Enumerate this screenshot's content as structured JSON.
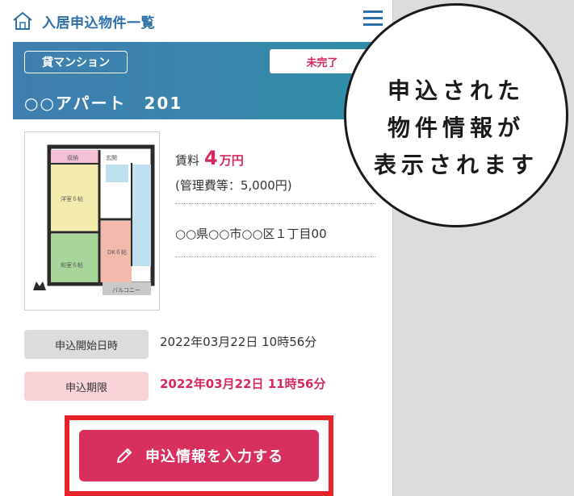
{
  "header": {
    "title": "入居申込物件一覧",
    "home_icon": "home-icon",
    "menu_icon": "hamburger-menu-icon"
  },
  "property": {
    "type_badge": "貸マンション",
    "status_badge": "未完了",
    "name": "○○アパート　201",
    "rent_label": "賃料",
    "rent_value": "4",
    "rent_unit": "万円",
    "management_fee": "(管理費等：5,000円)",
    "address": "○○県○○市○○区１丁目00"
  },
  "floorplan": {
    "rooms": {
      "storage": "収納",
      "entrance": "玄関",
      "western_room": "洋室６帖",
      "japanese_room": "和室６帖",
      "dk": "DK６帖",
      "balcony": "バルコニー"
    }
  },
  "application": {
    "start_label": "申込開始日時",
    "start_value": "2022年03月22日 10時56分",
    "deadline_label": "申込期限",
    "deadline_value": "2022年03月22日 11時56分"
  },
  "actions": {
    "submit_label": "申込情報を入力する",
    "submit_icon": "pencil-icon"
  },
  "callout": {
    "lines": [
      "申込された",
      "物件情報が",
      "表示されます"
    ]
  },
  "colors": {
    "accent": "#d6285a",
    "header_text": "#2c6fa8",
    "banner": "#3a85ad",
    "highlight_frame": "#e8242a"
  }
}
